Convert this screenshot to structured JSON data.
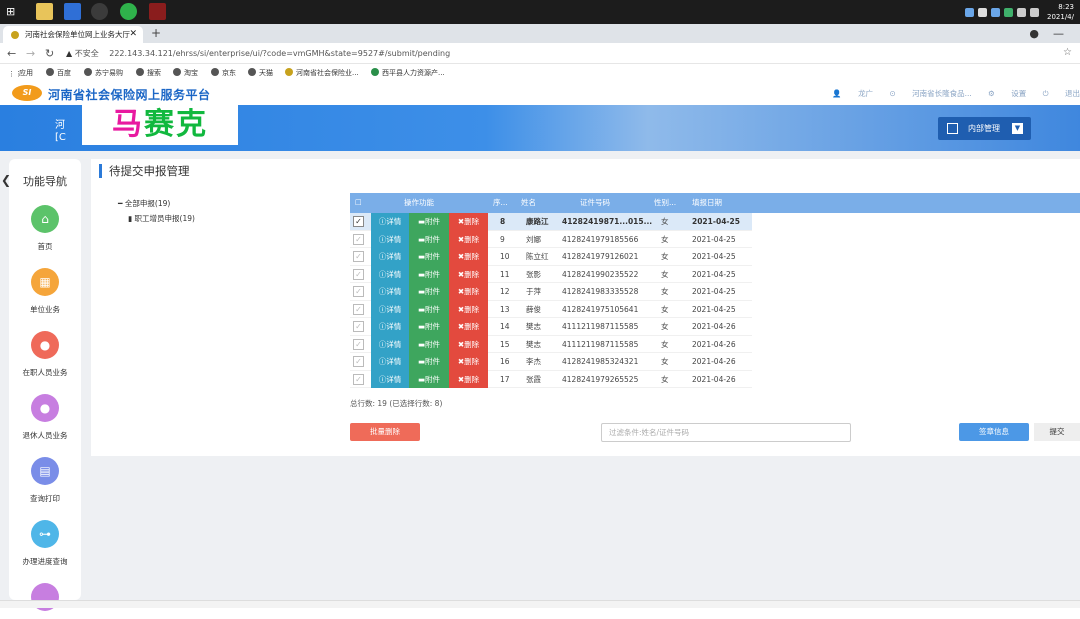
{
  "taskbar": {
    "time": "8:23",
    "date": "2021/4/"
  },
  "browser": {
    "tab_title": "河南社会保险单位网上业务大厅",
    "new_tab": "+",
    "security": "不安全",
    "url": "222.143.34.121/ehrss/si/enterprise/ui/?code=vmGMH&state=9527#/submit/pending",
    "bookmarks": [
      "应用",
      "百度",
      "苏宁易购",
      "搜索",
      "淘宝",
      "京东",
      "天猫",
      "河南省社会保险业...",
      "西平县人力资源产..."
    ]
  },
  "site": {
    "logo": "SI",
    "title": "河南省社会保险网上服务平台",
    "links": [
      "龙广",
      "河南省长隆食品...",
      "设置",
      "退出"
    ],
    "user_line1": "河",
    "user_line2": "[C",
    "mosaic_text_1": "马",
    "mosaic_text_2": "赛克",
    "internal_mgmt": "内部管理"
  },
  "sidebar": {
    "title": "功能导航",
    "items": [
      {
        "label": "首页",
        "icon": "home-icon",
        "color": "#5cc36a"
      },
      {
        "label": "单位业务",
        "icon": "building-icon",
        "color": "#f5a53a"
      },
      {
        "label": "在职人员业务",
        "icon": "people-icon",
        "color": "#ef6a5a"
      },
      {
        "label": "退休人员业务",
        "icon": "person-icon",
        "color": "#c77ee0"
      },
      {
        "label": "查询打印",
        "icon": "printer-icon",
        "color": "#7a8de8"
      },
      {
        "label": "办理进度查询",
        "icon": "progress-icon",
        "color": "#4fb6e8"
      }
    ]
  },
  "page": {
    "title": "待提交申报管理",
    "tree_root": "全部申报(19)",
    "tree_child": "职工增员申报(19)"
  },
  "grid": {
    "headers": [
      "操作功能",
      "序...",
      "姓名",
      "证件号码",
      "性别...",
      "填报日期"
    ],
    "btn_detail": "详情",
    "btn_attach": "附件",
    "btn_delete": "删除",
    "rows": [
      {
        "seq": "8",
        "name": "康路江",
        "id": "41282419871...015...",
        "sex": "女",
        "date": "2021-04-25",
        "selected": true,
        "bold": true
      },
      {
        "seq": "9",
        "name": "刘娜",
        "id": "4128241979185566",
        "sex": "女",
        "date": "2021-04-25",
        "selected": false
      },
      {
        "seq": "10",
        "name": "陈立红",
        "id": "4128241979126021",
        "sex": "女",
        "date": "2021-04-25",
        "selected": false
      },
      {
        "seq": "11",
        "name": "张影",
        "id": "4128241990235522",
        "sex": "女",
        "date": "2021-04-25",
        "selected": false
      },
      {
        "seq": "12",
        "name": "于萍",
        "id": "4128241983335528",
        "sex": "女",
        "date": "2021-04-25",
        "selected": false
      },
      {
        "seq": "13",
        "name": "薛俊",
        "id": "4128241975105641",
        "sex": "女",
        "date": "2021-04-25",
        "selected": false
      },
      {
        "seq": "14",
        "name": "樊志",
        "id": "4111211987115585",
        "sex": "女",
        "date": "2021-04-26",
        "selected": false
      },
      {
        "seq": "15",
        "name": "樊志",
        "id": "4111211987115585",
        "sex": "女",
        "date": "2021-04-26",
        "selected": false
      },
      {
        "seq": "16",
        "name": "李杰",
        "id": "4128241985324321",
        "sex": "女",
        "date": "2021-04-26",
        "selected": false
      },
      {
        "seq": "17",
        "name": "张霞",
        "id": "4128241979265525",
        "sex": "女",
        "date": "2021-04-26",
        "selected": false
      }
    ],
    "footer": "总行数: 19 (已选择行数: 8)"
  },
  "actions": {
    "batch_delete": "批量删除",
    "filter_placeholder": "过滤条件:姓名/证件号码",
    "sign": "签章信息",
    "submit": "提交"
  }
}
